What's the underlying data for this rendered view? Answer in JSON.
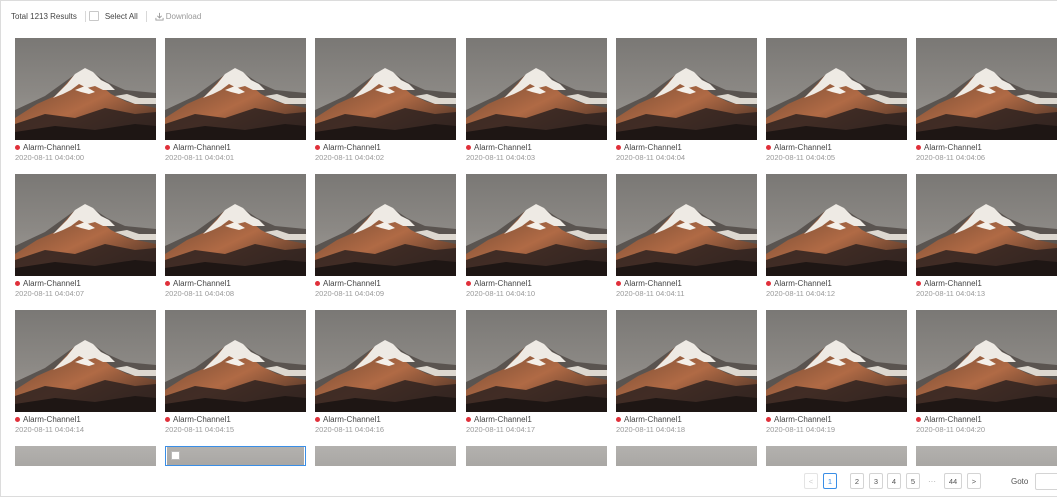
{
  "toolbar": {
    "total_label": "Total 1213 Results",
    "select_all_label": "Select All",
    "download_label": "Download"
  },
  "results": [
    {
      "channel": "Alarm-Channel1",
      "time": "2020-08-11 04:04:00"
    },
    {
      "channel": "Alarm-Channel1",
      "time": "2020-08-11 04:04:01"
    },
    {
      "channel": "Alarm-Channel1",
      "time": "2020-08-11 04:04:02"
    },
    {
      "channel": "Alarm-Channel1",
      "time": "2020-08-11 04:04:03"
    },
    {
      "channel": "Alarm-Channel1",
      "time": "2020-08-11 04:04:04"
    },
    {
      "channel": "Alarm-Channel1",
      "time": "2020-08-11 04:04:05"
    },
    {
      "channel": "Alarm-Channel1",
      "time": "2020-08-11 04:04:06"
    },
    {
      "channel": "Alarm-Channel1",
      "time": "2020-08-11 04:04:07"
    },
    {
      "channel": "Alarm-Channel1",
      "time": "2020-08-11 04:04:08"
    },
    {
      "channel": "Alarm-Channel1",
      "time": "2020-08-11 04:04:09"
    },
    {
      "channel": "Alarm-Channel1",
      "time": "2020-08-11 04:04:10"
    },
    {
      "channel": "Alarm-Channel1",
      "time": "2020-08-11 04:04:11"
    },
    {
      "channel": "Alarm-Channel1",
      "time": "2020-08-11 04:04:12"
    },
    {
      "channel": "Alarm-Channel1",
      "time": "2020-08-11 04:04:13"
    },
    {
      "channel": "Alarm-Channel1",
      "time": "2020-08-11 04:04:14"
    },
    {
      "channel": "Alarm-Channel1",
      "time": "2020-08-11 04:04:15"
    },
    {
      "channel": "Alarm-Channel1",
      "time": "2020-08-11 04:04:16"
    },
    {
      "channel": "Alarm-Channel1",
      "time": "2020-08-11 04:04:17"
    },
    {
      "channel": "Alarm-Channel1",
      "time": "2020-08-11 04:04:18"
    },
    {
      "channel": "Alarm-Channel1",
      "time": "2020-08-11 04:04:19"
    },
    {
      "channel": "Alarm-Channel1",
      "time": "2020-08-11 04:04:20"
    }
  ],
  "pagination": {
    "prev": "<",
    "pages": [
      "1",
      "2",
      "3",
      "4",
      "5"
    ],
    "ellipsis": "···",
    "last_page": "44",
    "next": ">",
    "goto_label": "Goto",
    "current_page": 1
  },
  "colors": {
    "accent": "#3a8ee6",
    "alarm_dot": "#e0303a"
  },
  "icons": {
    "download": "download-icon",
    "alarm": "alarm-dot-icon"
  }
}
